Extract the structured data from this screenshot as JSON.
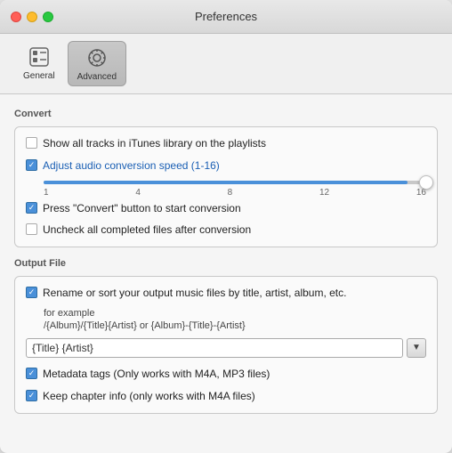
{
  "window": {
    "title": "Preferences"
  },
  "toolbar": {
    "buttons": [
      {
        "id": "general",
        "label": "General",
        "active": false
      },
      {
        "id": "advanced",
        "label": "Advanced",
        "active": true
      }
    ]
  },
  "convert_section": {
    "label": "Convert",
    "options": [
      {
        "id": "show-all-tracks",
        "checked": false,
        "label": "Show all tracks in iTunes library on the playlists"
      },
      {
        "id": "adjust-audio",
        "checked": true,
        "label": "Adjust audio conversion speed (1-16)"
      },
      {
        "id": "press-convert",
        "checked": true,
        "label": "Press \"Convert\" button to start conversion"
      },
      {
        "id": "uncheck-completed",
        "checked": false,
        "label": "Uncheck all completed files after conversion"
      }
    ],
    "slider": {
      "min": 1,
      "max": 16,
      "value": 16,
      "labels": [
        "1",
        "4",
        "8",
        "12",
        "16"
      ]
    }
  },
  "output_section": {
    "label": "Output File",
    "options": [
      {
        "id": "rename-sort",
        "checked": true,
        "label": "Rename or sort your output music files by title, artist, album, etc."
      },
      {
        "id": "metadata-tags",
        "checked": true,
        "label": "Metadata tags (Only works with M4A, MP3 files)"
      },
      {
        "id": "keep-chapter",
        "checked": true,
        "label": "Keep chapter info (only works with  M4A files)"
      }
    ],
    "example_label": "for example",
    "example_format": "/{Album}/{Title}{Artist} or {Album}-{Title}-{Artist}",
    "input_value": "{Title} {Artist}",
    "dropdown_icon": "▼"
  }
}
